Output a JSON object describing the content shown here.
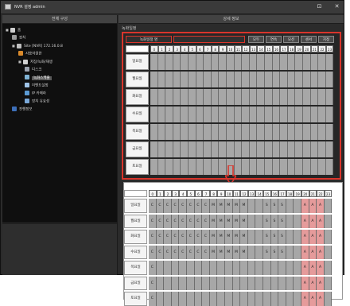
{
  "window": {
    "title": "NVR 설정 admin",
    "close_label": "✕",
    "pin_label": "⊡"
  },
  "left_pane": {
    "header": "전체 구성"
  },
  "right_pane": {
    "header": "상세 정보",
    "section_label": "녹화일정"
  },
  "tree": [
    {
      "label": "홈",
      "icon": "home-icon",
      "color": "#cfcfcf"
    },
    {
      "label": "장치",
      "icon": "device-icon",
      "color": "#9a9a9a"
    },
    {
      "label": "Site [NVR] 172.16.0.8",
      "icon": "nvr-icon",
      "color": "#bfbfbf"
    },
    {
      "label": "사용자권한",
      "icon": "users-icon",
      "color": "#d98a2b"
    },
    {
      "label": "저장/녹화/재생",
      "icon": "storage-icon",
      "color": "#d0d0d0"
    },
    {
      "label": "디스크",
      "icon": "disk-icon",
      "color": "#9ca3af"
    },
    {
      "label": "녹화스케줄",
      "icon": "schedule-icon",
      "color": "#7fb3d5"
    },
    {
      "label": "이벤트설정",
      "icon": "event-icon",
      "color": "#a0c4e8"
    },
    {
      "label": "IP 카메라",
      "icon": "camera-icon",
      "color": "#5b9bd5"
    },
    {
      "label": "장치 유효성",
      "icon": "check-icon",
      "color": "#7aa8d8"
    },
    {
      "label": "진행정보",
      "icon": "info-icon",
      "color": "#3d6fb8"
    }
  ],
  "top_controls": {
    "schedule_name": "녹화일정 명",
    "buttons": [
      "모두",
      "연속",
      "모션",
      "센서",
      "지정"
    ]
  },
  "hours": [
    "0",
    "1",
    "2",
    "3",
    "4",
    "5",
    "6",
    "7",
    "8",
    "9",
    "10",
    "11",
    "12",
    "13",
    "14",
    "15",
    "16",
    "17",
    "18",
    "19",
    "20",
    "21",
    "22",
    "23"
  ],
  "days": [
    "일요일",
    "월요일",
    "화요일",
    "수요일",
    "목요일",
    "금요일",
    "토요일"
  ],
  "schedule_bottom": {
    "일요일": {
      "0": "C",
      "1": "C",
      "2": "C",
      "3": "C",
      "4": "C",
      "5": "C",
      "6": "C",
      "7": "C",
      "8": "M",
      "9": "M",
      "10": "M",
      "11": "M",
      "12": "M",
      "15": "S",
      "16": "S",
      "17": "S",
      "20": "A",
      "21": "A",
      "22": "A"
    },
    "월요일": {
      "0": "C",
      "1": "C",
      "2": "C",
      "3": "C",
      "4": "C",
      "5": "C",
      "6": "C",
      "7": "C",
      "8": "M",
      "9": "M",
      "10": "M",
      "11": "M",
      "12": "M",
      "15": "S",
      "16": "S",
      "17": "S",
      "20": "A",
      "21": "A",
      "22": "A"
    },
    "화요일": {
      "0": "C",
      "1": "C",
      "2": "C",
      "3": "C",
      "4": "C",
      "5": "C",
      "6": "C",
      "7": "C",
      "8": "M",
      "9": "M",
      "10": "M",
      "11": "M",
      "12": "M",
      "15": "S",
      "16": "S",
      "17": "S",
      "20": "A",
      "21": "A",
      "22": "A"
    },
    "수요일": {
      "0": "C",
      "1": "C",
      "2": "C",
      "3": "C",
      "4": "C",
      "5": "C",
      "6": "C",
      "7": "C",
      "8": "M",
      "9": "M",
      "10": "M",
      "11": "M",
      "12": "M",
      "15": "S",
      "16": "S",
      "17": "S",
      "20": "A",
      "21": "A",
      "22": "A"
    },
    "목요일": {
      "0": "C",
      "20": "A",
      "21": "A",
      "22": "A"
    },
    "금요일": {
      "0": "C",
      "20": "A",
      "21": "A",
      "22": "A"
    },
    "토요일": {
      "0": "C",
      "20": "A",
      "21": "A",
      "22": "A"
    }
  },
  "colors": {
    "accent_red": "#d9352c",
    "cell_gray": "#a7a7a7",
    "cell_red": "#e59b9b"
  }
}
